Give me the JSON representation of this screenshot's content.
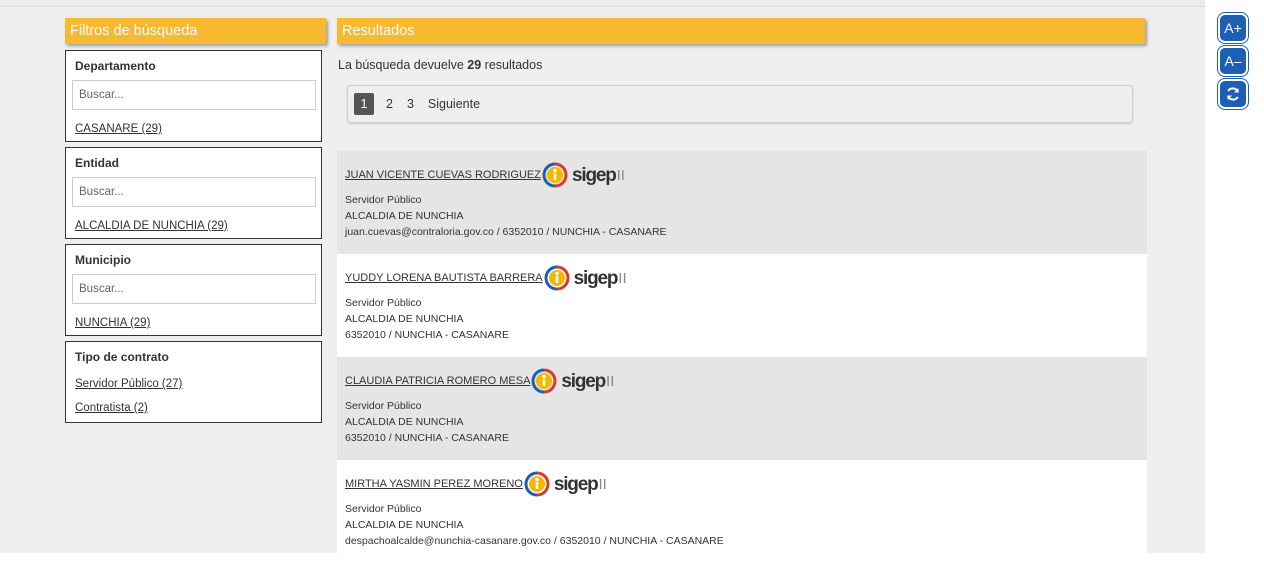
{
  "sidebar": {
    "header": "Filtros de búsqueda",
    "filters": [
      {
        "title": "Departamento",
        "placeholder": "Buscar...",
        "options": [
          "CASANARE (29)"
        ]
      },
      {
        "title": "Entidad",
        "placeholder": "Buscar...",
        "options": [
          "ALCALDIA DE NUNCHIA (29)"
        ]
      },
      {
        "title": "Municipio",
        "placeholder": "Buscar...",
        "options": [
          "NUNCHIA (29)"
        ]
      },
      {
        "title": "Tipo de contrato",
        "options": [
          "Servidor Público (27)",
          "Contratista (2)"
        ]
      }
    ]
  },
  "results": {
    "header": "Resultados",
    "summary_prefix": "La búsqueda devuelve ",
    "count": "29",
    "summary_suffix": " resultados",
    "pagination": {
      "pages": [
        "1",
        "2",
        "3"
      ],
      "active": "1",
      "next": "Siguiente"
    },
    "logo": {
      "word": "sigep",
      "roman": "II"
    },
    "items": [
      {
        "name": "JUAN VICENTE CUEVAS RODRIGUEZ",
        "role": "Servidor Público",
        "entity": "ALCALDIA DE NUNCHIA",
        "contact": "juan.cuevas@contraloria.gov.co / 6352010 / NUNCHIA - CASANARE"
      },
      {
        "name": "YUDDY LORENA BAUTISTA BARRERA",
        "role": "Servidor Público",
        "entity": "ALCALDIA DE NUNCHIA",
        "contact": "6352010 / NUNCHIA - CASANARE"
      },
      {
        "name": "CLAUDIA PATRICIA ROMERO MESA",
        "role": "Servidor Público",
        "entity": "ALCALDIA DE NUNCHIA",
        "contact": "6352010 / NUNCHIA - CASANARE"
      },
      {
        "name": "MIRTHA YASMIN PEREZ MORENO",
        "role": "Servidor Público",
        "entity": "ALCALDIA DE NUNCHIA",
        "contact": "despachoalcalde@nunchia-casanare.gov.co / 6352010 / NUNCHIA - CASANARE"
      }
    ]
  },
  "tools": {
    "increase": "A+",
    "decrease": "A–",
    "reset_icon": "refresh-icon"
  },
  "colors": {
    "accent": "#f7b832",
    "tool_blue": "#1d5fb3",
    "row_alt": "#e5e5e5",
    "page_bg": "#efefef"
  }
}
